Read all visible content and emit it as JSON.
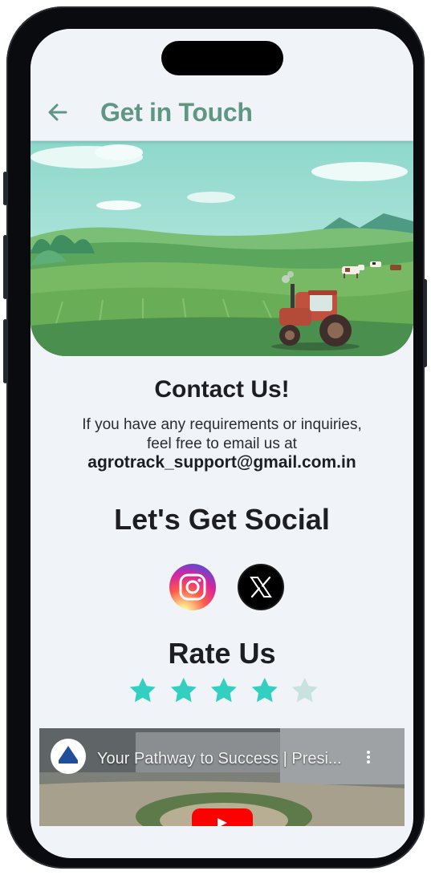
{
  "appbar": {
    "title": "Get in Touch"
  },
  "contact": {
    "title": "Contact Us!",
    "line1": "If you have any requirements or inquiries,",
    "line2": "feel free to email us at",
    "email": "agrotrack_support@gmail.com.in"
  },
  "social": {
    "title": "Let's Get Social",
    "icons": [
      "instagram-icon",
      "x-twitter-icon"
    ]
  },
  "rating": {
    "title": "Rate Us",
    "value": 4,
    "max": 5,
    "filled_color": "#33cfc0",
    "empty_color": "#c8e3df"
  },
  "video": {
    "title": "Your Pathway to Success | Presi..."
  },
  "colors": {
    "accent": "#5f9783",
    "background": "#f0f3f8"
  }
}
